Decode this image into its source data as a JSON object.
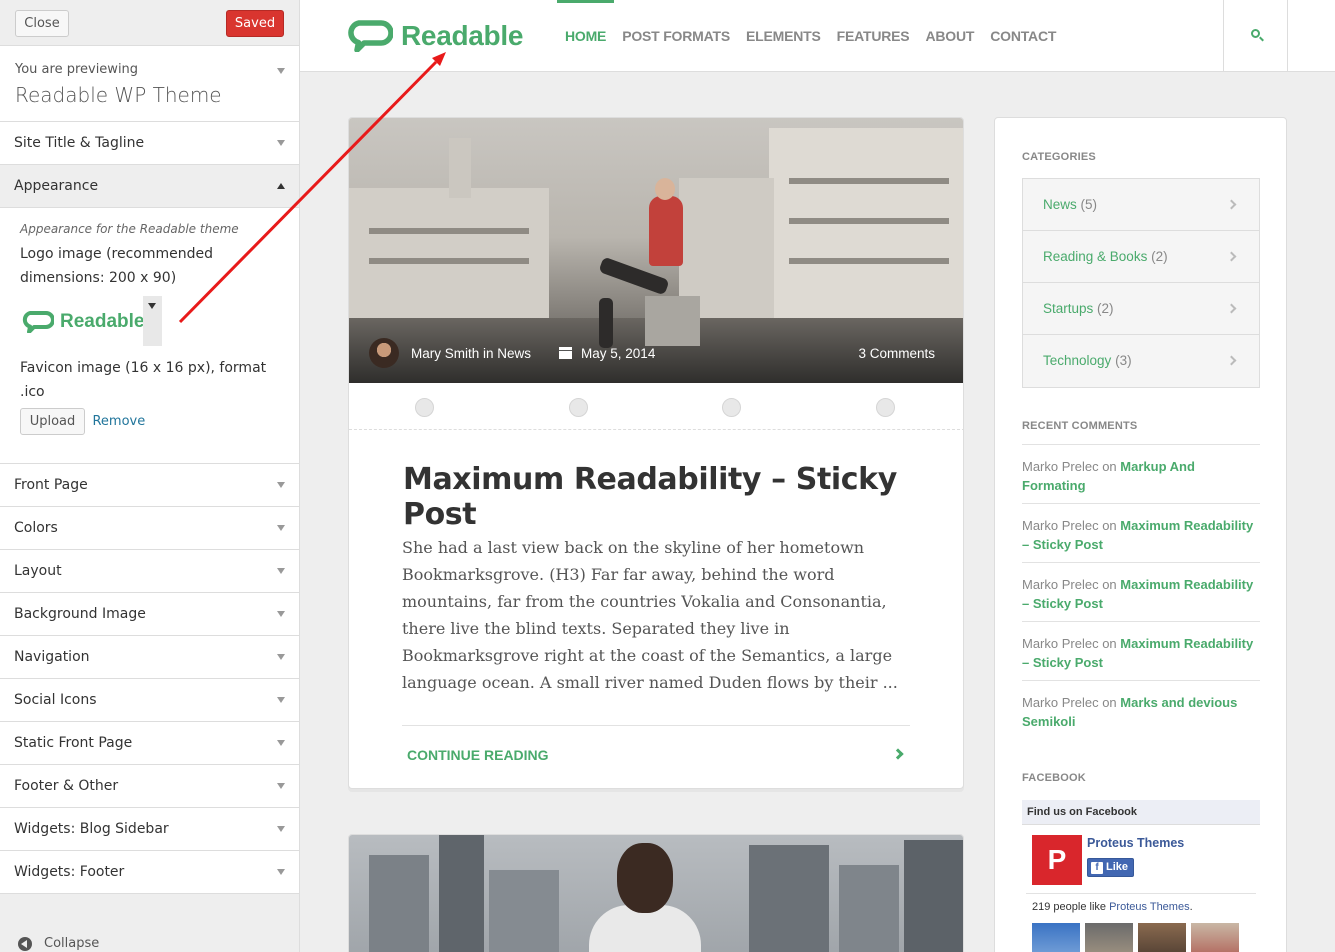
{
  "customizer": {
    "close_label": "Close",
    "saved_label": "Saved",
    "preview_label": "You are previewing",
    "theme_name": "Readable WP Theme",
    "sections": [
      "Site Title & Tagline",
      "Appearance",
      "Front Page",
      "Colors",
      "Layout",
      "Background Image",
      "Navigation",
      "Social Icons",
      "Static Front Page",
      "Footer & Other",
      "Widgets: Blog Sidebar",
      "Widgets: Footer"
    ],
    "appearance": {
      "description": "Appearance for the Readable theme",
      "logo_label": "Logo image (recommended dimensions: 200 x 90)",
      "logo_word": "Readable",
      "favicon_label": "Favicon image (16 x 16 px), format .ico",
      "upload_label": "Upload",
      "remove_label": "Remove"
    },
    "collapse_label": "Collapse"
  },
  "site": {
    "brand": "Readable",
    "accent": "#4aaa6c",
    "nav": [
      "HOME",
      "POST FORMATS",
      "ELEMENTS",
      "FEATURES",
      "ABOUT",
      "CONTACT"
    ],
    "post": {
      "author": "Mary Smith in News",
      "date": "May 5, 2014",
      "comments": "3 Comments",
      "title": "Maximum Readability – Sticky Post",
      "excerpt": "She had a last view back on the skyline of her hometown Bookmarksgrove. (H3) Far far away, behind the word mountains, far from the countries Vokalia and Consonantia, there live the blind texts. Separated they live in Bookmarksgrove right at the coast of the Semantics, a large language ocean. A small river named Duden flows by their ...",
      "continue_label": "CONTINUE READING"
    },
    "widgets": {
      "categories_title": "CATEGORIES",
      "categories": [
        {
          "name": "News",
          "count": "(5)"
        },
        {
          "name": "Reading & Books",
          "count": "(2)"
        },
        {
          "name": "Startups",
          "count": "(2)"
        },
        {
          "name": "Technology",
          "count": "(3)"
        }
      ],
      "recent_comments_title": "RECENT COMMENTS",
      "recent_comments": [
        {
          "author": "Marko Prelec",
          "on": "on",
          "post": "Markup And Formating"
        },
        {
          "author": "Marko Prelec",
          "on": "on",
          "post": "Maximum Readability – Sticky Post"
        },
        {
          "author": "Marko Prelec",
          "on": "on",
          "post": "Maximum Readability – Sticky Post"
        },
        {
          "author": "Marko Prelec",
          "on": "on",
          "post": "Maximum Readability – Sticky Post"
        },
        {
          "author": "Marko Prelec",
          "on": "on",
          "post": "Marks and devious Semikoli"
        }
      ],
      "facebook_title": "FACEBOOK",
      "facebook": {
        "header": "Find us on Facebook",
        "page_name": "Proteus Themes",
        "logo_letter": "P",
        "like_label": "Like",
        "like_letter": "f",
        "count_text": "219 people like",
        "count_link": "Proteus Themes",
        "count_end": "."
      }
    }
  }
}
